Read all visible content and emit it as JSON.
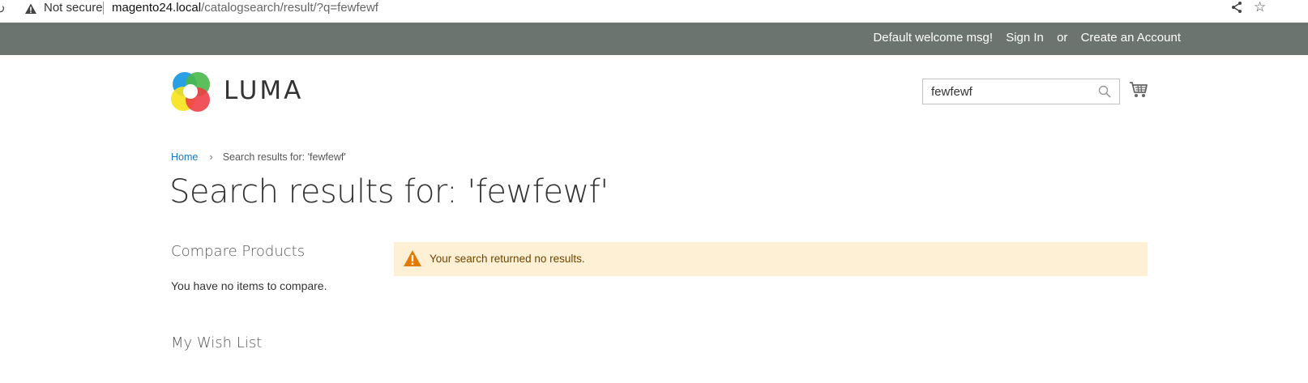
{
  "browser": {
    "security_label": "Not secure",
    "url_host": "magento24.local",
    "url_path": "/catalogsearch/result/?q=fewfewf"
  },
  "top_panel": {
    "welcome": "Default welcome msg!",
    "sign_in": "Sign In",
    "or": "or",
    "create_account": "Create an Account"
  },
  "header": {
    "logo_text": "LUMA",
    "search_value": "fewfewf"
  },
  "breadcrumb": {
    "home": "Home",
    "separator": "›",
    "current": "Search results for: 'fewfewf'"
  },
  "page_title": "Search results for: 'fewfewf'",
  "sidebar": {
    "compare_title": "Compare Products",
    "compare_empty": "You have no items to compare.",
    "wishlist_title": "My Wish List"
  },
  "notice": {
    "message": "Your search returned no results."
  },
  "colors": {
    "top_panel_bg": "#6b746f",
    "link": "#1979c3",
    "notice_bg": "#fdf0d5",
    "notice_icon": "#e07b00"
  },
  "icons": [
    "reload-icon",
    "warning-icon",
    "share-icon",
    "star-icon",
    "search-icon",
    "cart-icon",
    "notice-warning-icon"
  ]
}
